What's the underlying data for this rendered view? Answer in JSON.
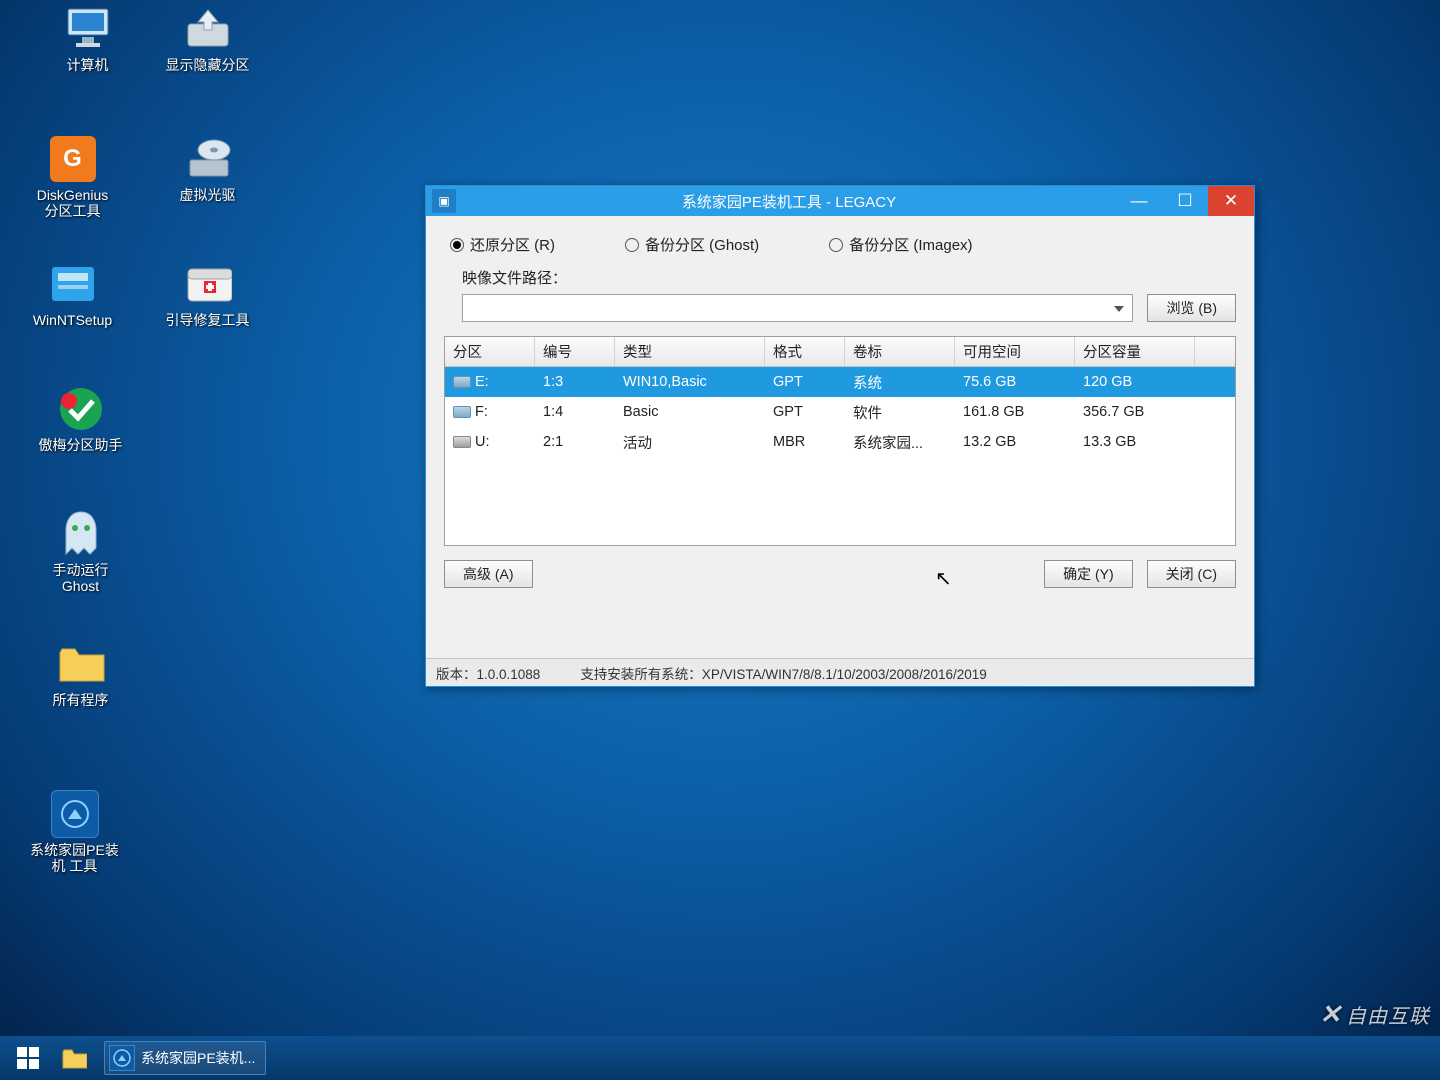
{
  "desktop": {
    "icons": [
      {
        "label": "计算机"
      },
      {
        "label": "显示隐藏分区"
      },
      {
        "label": "DiskGenius\n分区工具"
      },
      {
        "label": "虚拟光驱"
      },
      {
        "label": "WinNTSetup"
      },
      {
        "label": "引导修复工具"
      },
      {
        "label": "傲梅分区助手"
      },
      {
        "label": "手动运行\nGhost"
      },
      {
        "label": "所有程序"
      },
      {
        "label": "系统家园PE装\n机 工具"
      }
    ]
  },
  "taskbar": {
    "app_label": "系统家园PE装机..."
  },
  "watermark": "自由互联",
  "window": {
    "title": "系统家园PE装机工具 - LEGACY",
    "radios": {
      "restore": "还原分区 (R)",
      "backup_ghost": "备份分区 (Ghost)",
      "backup_imagex": "备份分区 (Imagex)"
    },
    "image_path_label": "映像文件路径：",
    "image_path_value": "",
    "browse": "浏览 (B)",
    "columns": {
      "partition": "分区",
      "number": "编号",
      "type": "类型",
      "format": "格式",
      "label": "卷标",
      "free": "可用空间",
      "size": "分区容量"
    },
    "rows": [
      {
        "drive": "E:",
        "num": "1:3",
        "type": "WIN10,Basic",
        "fmt": "GPT",
        "label": "系统",
        "free": "75.6 GB",
        "size": "120 GB",
        "sel": true,
        "usb": false
      },
      {
        "drive": "F:",
        "num": "1:4",
        "type": "Basic",
        "fmt": "GPT",
        "label": "软件",
        "free": "161.8 GB",
        "size": "356.7 GB",
        "sel": false,
        "usb": false
      },
      {
        "drive": "U:",
        "num": "2:1",
        "type": "活动",
        "fmt": "MBR",
        "label": "系统家园...",
        "free": "13.2 GB",
        "size": "13.3 GB",
        "sel": false,
        "usb": true
      }
    ],
    "advanced": "高级 (A)",
    "ok": "确定 (Y)",
    "close": "关闭 (C)",
    "version": "版本：1.0.0.1088",
    "supports": "支持安装所有系统：XP/VISTA/WIN7/8/8.1/10/2003/2008/2016/2019"
  }
}
